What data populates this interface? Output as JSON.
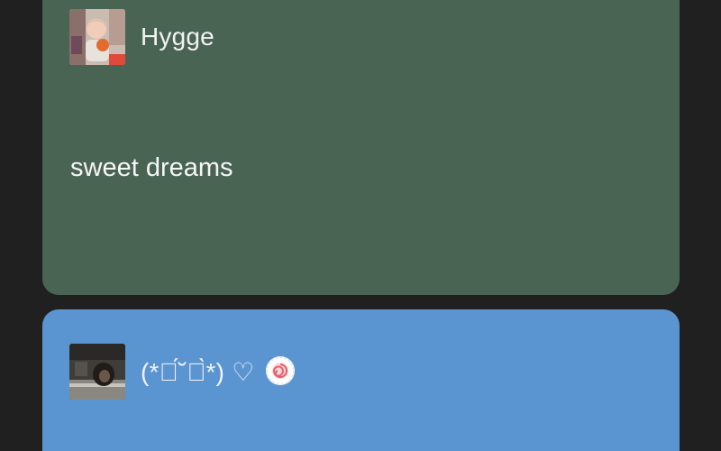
{
  "feed": {
    "background_color": "#202020",
    "posts": [
      {
        "card_color": "#4a6454",
        "author": "Hygge",
        "avatar": "baby-photo-avatar",
        "text": "sweet dreams"
      },
      {
        "card_color": "#5b95d1",
        "author": "(*ต́˘ต̀*) ♡",
        "avatar": "dark-photo-avatar",
        "badge": "swirl-badge-icon"
      }
    ]
  }
}
